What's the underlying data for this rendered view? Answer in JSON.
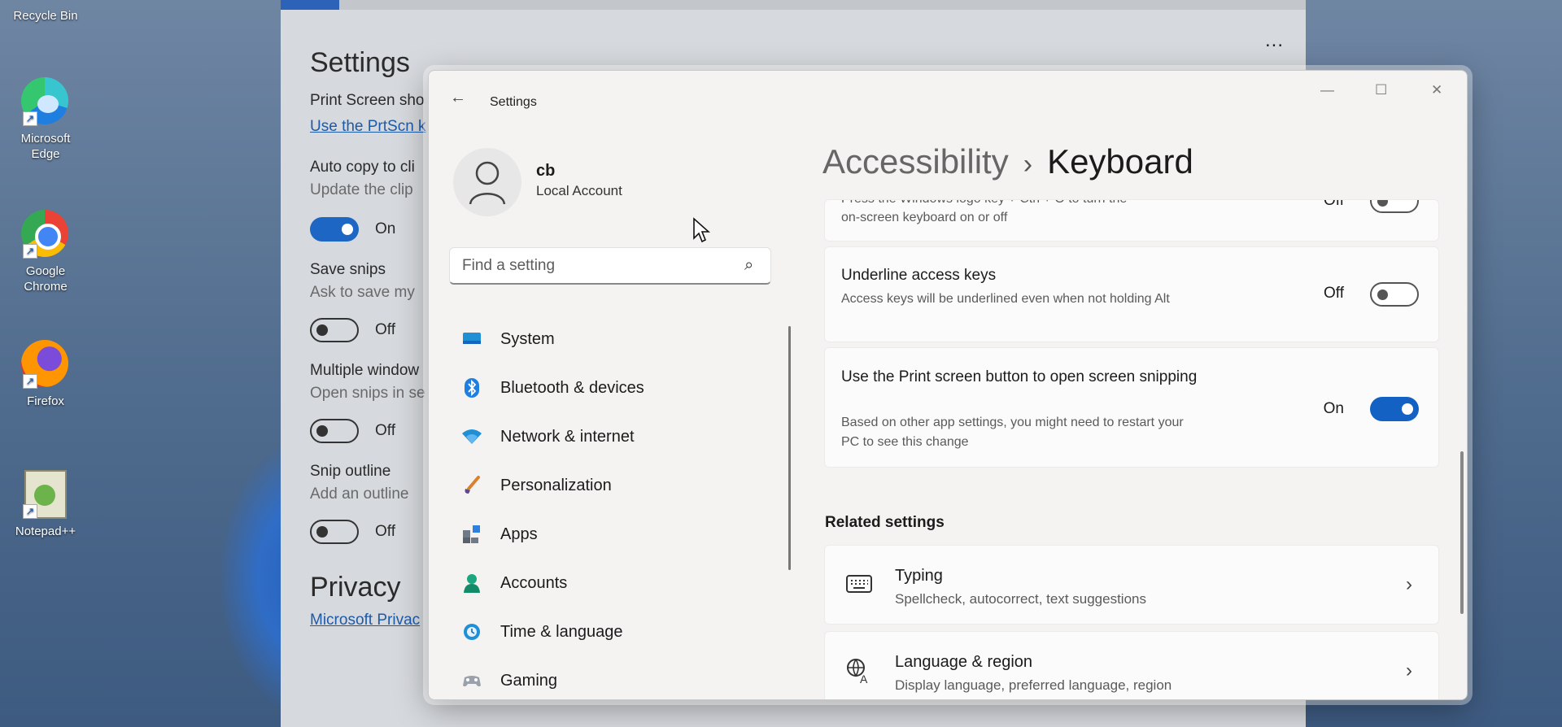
{
  "desktop": {
    "icons": [
      {
        "label": "Recycle Bin"
      },
      {
        "label": "Microsoft Edge"
      },
      {
        "label": "Google Chrome"
      },
      {
        "label": "Firefox"
      },
      {
        "label": "Notepad++"
      }
    ]
  },
  "bg_window": {
    "heading": "Settings",
    "print_screen_label": "Print Screen sho",
    "prtscn_link": "Use the PrtScn k",
    "auto_copy_label": "Auto copy to cli",
    "auto_copy_sub": "Update the clip",
    "auto_copy_state": "On",
    "save_snips_label": "Save snips",
    "save_snips_sub": "Ask to save my",
    "save_snips_state": "Off",
    "multiple_windows_label": "Multiple window",
    "multiple_windows_sub": "Open snips in se",
    "multiple_windows_state": "Off",
    "snip_outline_label": "Snip outline",
    "snip_outline_sub": "Add an outline",
    "snip_outline_state": "Off",
    "privacy_heading": "Privacy",
    "privacy_link": "Microsoft Privac",
    "more_label": "..."
  },
  "window": {
    "title": "Settings",
    "user": {
      "name": "cb",
      "account_type": "Local Account"
    },
    "search": {
      "placeholder": "Find a setting"
    },
    "nav": [
      {
        "label": "System",
        "icon": "monitor-icon"
      },
      {
        "label": "Bluetooth & devices",
        "icon": "bluetooth-icon"
      },
      {
        "label": "Network & internet",
        "icon": "wifi-icon"
      },
      {
        "label": "Personalization",
        "icon": "brush-icon"
      },
      {
        "label": "Apps",
        "icon": "apps-icon"
      },
      {
        "label": "Accounts",
        "icon": "person-icon"
      },
      {
        "label": "Time & language",
        "icon": "globe-clock-icon"
      },
      {
        "label": "Gaming",
        "icon": "controller-icon"
      }
    ],
    "breadcrumb": {
      "parent": "Accessibility",
      "separator": "›",
      "current": "Keyboard"
    },
    "settings": [
      {
        "title": "Press the Windows logo key + Ctrl + O to turn the",
        "subtitle": "on-screen keyboard on or off",
        "state": "Off",
        "on": false
      },
      {
        "title": "Underline access keys",
        "subtitle": "Access keys will be underlined even when not holding Alt",
        "state": "Off",
        "on": false
      },
      {
        "title": "Use the Print screen button to open screen snipping",
        "subtitle": "Based on other app settings, you might need to restart your PC to see this change",
        "state": "On",
        "on": true
      }
    ],
    "related": {
      "heading": "Related settings",
      "items": [
        {
          "title": "Typing",
          "subtitle": "Spellcheck, autocorrect, text suggestions",
          "icon": "keyboard-icon"
        },
        {
          "title": "Language & region",
          "subtitle": "Display language, preferred language, region",
          "icon": "language-icon"
        }
      ]
    },
    "colors": {
      "accent": "#1461c4",
      "background": "#f4f3f2",
      "card": "#fbfbfb"
    }
  }
}
